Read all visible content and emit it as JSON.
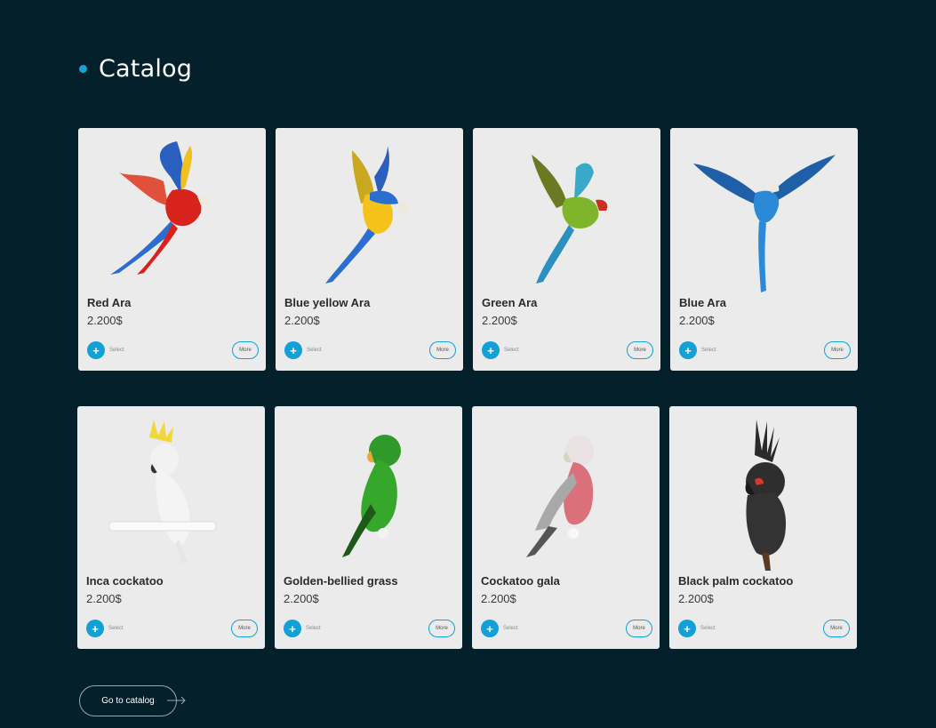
{
  "header": {
    "title": "Catalog"
  },
  "colors": {
    "background": "#03202b",
    "accent": "#14a0d8",
    "card": "#ebebeb"
  },
  "products": [
    {
      "name": "Red Ara",
      "price": "2.200$",
      "select_label": "Select",
      "more_label": "More",
      "image": "red-macaw-icon"
    },
    {
      "name": "Blue yellow Ara",
      "price": "2.200$",
      "select_label": "Select",
      "more_label": "More",
      "image": "blue-yellow-macaw-icon"
    },
    {
      "name": "Green Ara",
      "price": "2.200$",
      "select_label": "Select",
      "more_label": "More",
      "image": "green-macaw-icon"
    },
    {
      "name": "Blue Ara",
      "price": "2.200$",
      "select_label": "Select",
      "more_label": "More",
      "image": "blue-macaw-icon"
    },
    {
      "name": "Inca cockatoo",
      "price": "2.200$",
      "select_label": "Select",
      "more_label": "More",
      "image": "inca-cockatoo-icon"
    },
    {
      "name": "Golden-bellied grass",
      "price": "2.200$",
      "select_label": "Select",
      "more_label": "More",
      "image": "green-parrot-icon"
    },
    {
      "name": "Cockatoo gala",
      "price": "2.200$",
      "select_label": "Select",
      "more_label": "More",
      "image": "galah-cockatoo-icon"
    },
    {
      "name": "Black palm cockatoo",
      "price": "2.200$",
      "select_label": "Select",
      "more_label": "More",
      "image": "palm-cockatoo-icon"
    }
  ],
  "footer": {
    "goto_label": "Go to catalog"
  }
}
